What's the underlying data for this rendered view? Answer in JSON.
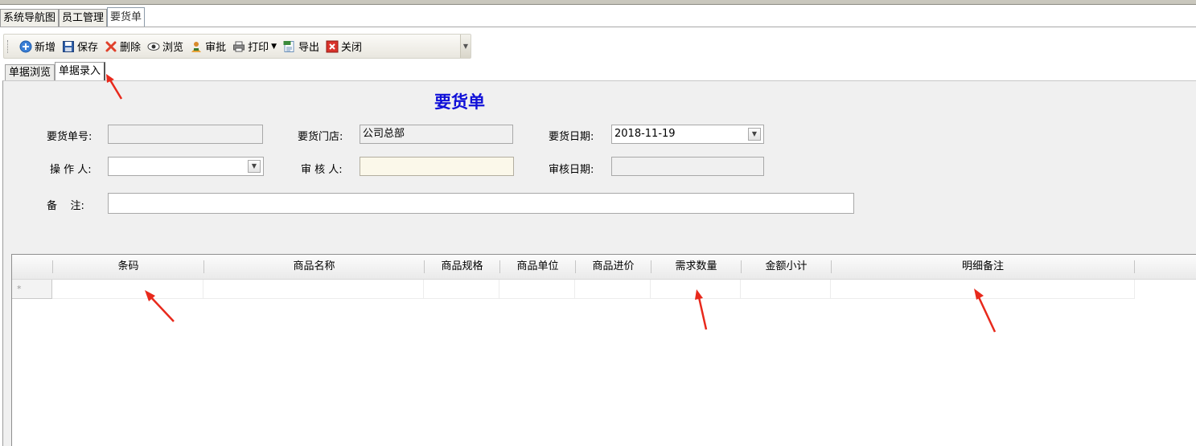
{
  "doc_tabs": [
    {
      "label": "系统导航图",
      "active": false
    },
    {
      "label": "员工管理",
      "active": false
    },
    {
      "label": "要货单",
      "active": true
    }
  ],
  "toolbar": {
    "new": "新增",
    "save": "保存",
    "delete": "删除",
    "browse": "浏览",
    "approve": "审批",
    "print": "打印",
    "export": "导出",
    "close": "关闭"
  },
  "inner_tabs": [
    {
      "label": "单据浏览",
      "active": false
    },
    {
      "label": "单据录入",
      "active": true
    }
  ],
  "form": {
    "title": "要货单",
    "order_no": {
      "label": "要货单号:",
      "value": ""
    },
    "store": {
      "label": "要货门店:",
      "value": "公司总部"
    },
    "order_date": {
      "label": "要货日期:",
      "value": "2018-11-19"
    },
    "operator": {
      "label": "操 作 人:",
      "value": ""
    },
    "reviewer": {
      "label": "审 核 人:",
      "value": ""
    },
    "review_date": {
      "label": "审核日期:",
      "value": ""
    },
    "remark": {
      "label": "备    注:",
      "value": ""
    }
  },
  "grid": {
    "columns": [
      "条码",
      "商品名称",
      "商品规格",
      "商品单位",
      "商品进价",
      "需求数量",
      "金额小计",
      "明细备注"
    ],
    "new_row_marker": "*"
  },
  "colors": {
    "title_blue": "#1010d8",
    "arrow_red": "#e8291c",
    "panel_bg": "#f0f0f0"
  }
}
